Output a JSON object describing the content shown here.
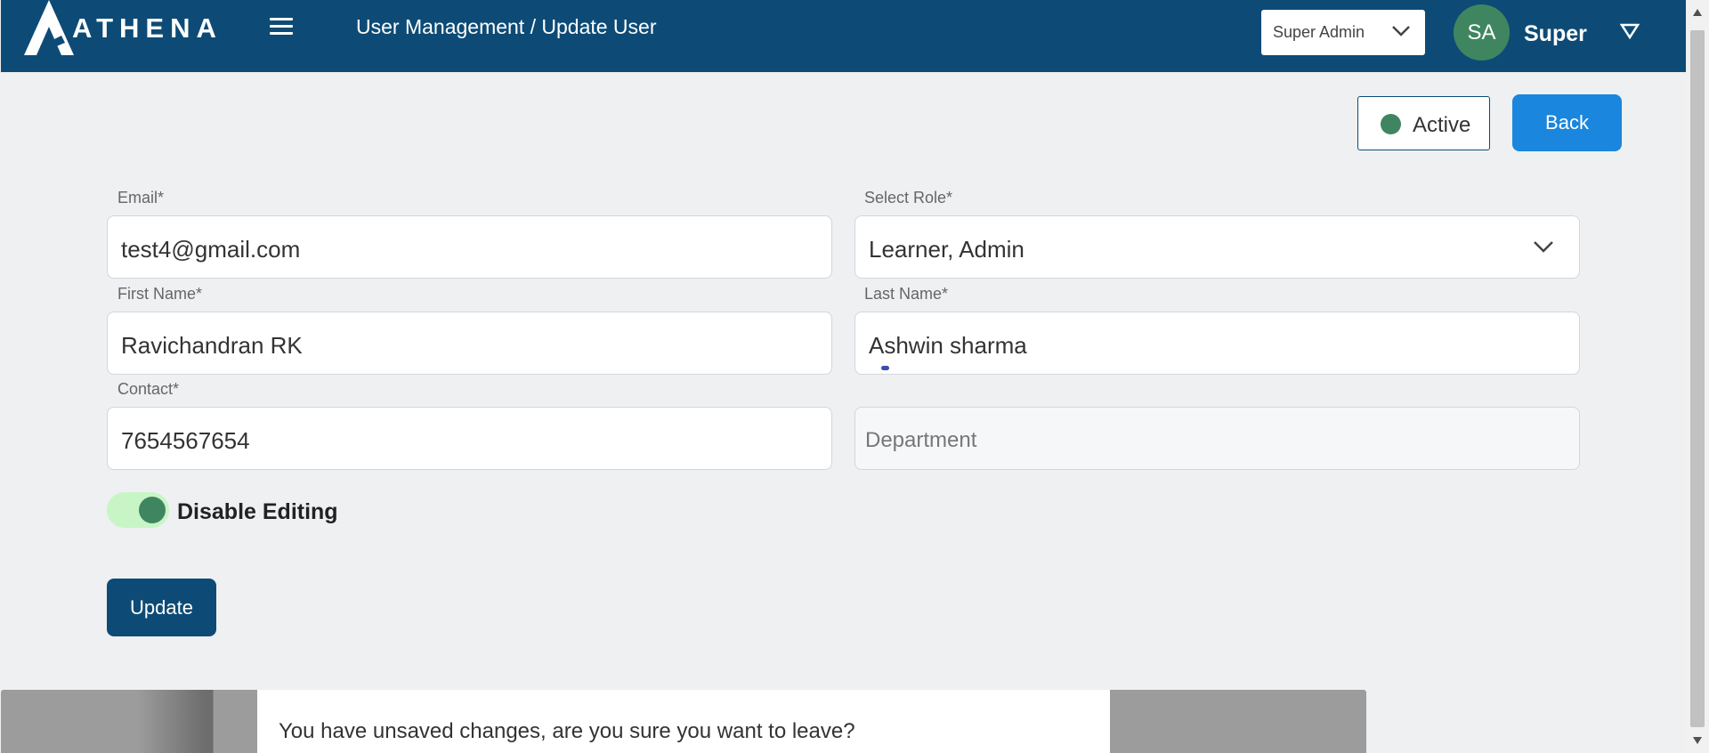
{
  "header": {
    "logo_text": "ATHENA",
    "breadcrumb": "User Management / Update User",
    "role_select": {
      "value": "Super Admin"
    },
    "avatar_initials": "SA",
    "user_name": "Super"
  },
  "status": {
    "label": "Active",
    "color": "#3f8660"
  },
  "back_label": "Back",
  "form": {
    "email": {
      "label": "Email*",
      "value": "test4@gmail.com"
    },
    "role": {
      "label": "Select Role*",
      "value": "Learner, Admin"
    },
    "first_name": {
      "label": "First Name*",
      "value": "Ravichandran RK"
    },
    "last_name": {
      "label": "Last Name*",
      "value": "Ashwin sharma"
    },
    "contact": {
      "label": "Contact*",
      "value": "7654567654"
    },
    "department": {
      "placeholder": "Department"
    }
  },
  "toggle": {
    "label": "Disable Editing",
    "on": true
  },
  "update_label": "Update",
  "dialog": {
    "message": "You have unsaved changes, are you sure you want to leave?"
  },
  "colors": {
    "header": "#0d4b76",
    "accent": "#1a86dd",
    "success": "#3f8660"
  }
}
